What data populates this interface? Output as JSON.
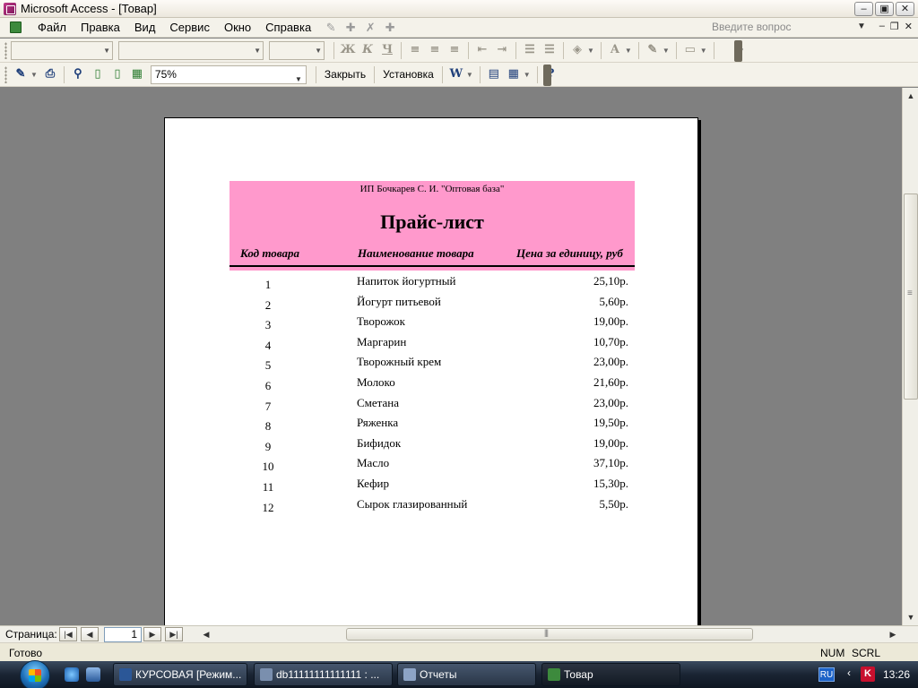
{
  "window": {
    "title": "Microsoft Access - [Товар]"
  },
  "menu": {
    "items": [
      {
        "label": "Файл"
      },
      {
        "label": "Правка"
      },
      {
        "label": "Вид"
      },
      {
        "label": "Сервис"
      },
      {
        "label": "Окно"
      },
      {
        "label": "Справка"
      }
    ],
    "ask_placeholder": "Введите вопрос"
  },
  "format_toolbar": {
    "bold_icon": "Ж",
    "italic_icon": "К",
    "underline_icon": "Ч",
    "font_color_icon": "A"
  },
  "preview_toolbar": {
    "zoom": "75%",
    "close_label": "Закрыть",
    "setup_label": "Установка"
  },
  "report": {
    "company": "ИП Бочкарев С. И. \"Оптовая база\"",
    "title": "Прайс-лист",
    "columns": [
      "Код товара",
      "Наименование товара",
      "Цена за единицу, руб"
    ],
    "header_bg": "#ff99cc",
    "rows": [
      {
        "code": "1",
        "name": "Напиток йогуртный",
        "price": "25,10р."
      },
      {
        "code": "2",
        "name": "Йогурт питьевой",
        "price": "5,60р."
      },
      {
        "code": "3",
        "name": "Творожок",
        "price": "19,00р."
      },
      {
        "code": "4",
        "name": "Маргарин",
        "price": "10,70р."
      },
      {
        "code": "5",
        "name": "Творожный крем",
        "price": "23,00р."
      },
      {
        "code": "6",
        "name": "Молоко",
        "price": "21,60р."
      },
      {
        "code": "7",
        "name": "Сметана",
        "price": "23,00р."
      },
      {
        "code": "8",
        "name": "Ряженка",
        "price": "19,50р."
      },
      {
        "code": "9",
        "name": "Бифидок",
        "price": "19,00р."
      },
      {
        "code": "10",
        "name": "Масло",
        "price": "37,10р."
      },
      {
        "code": "11",
        "name": "Кефир",
        "price": "15,30р."
      },
      {
        "code": "12",
        "name": "Сырок глазированный",
        "price": "5,50р."
      }
    ]
  },
  "navigation": {
    "label": "Страница:",
    "page": "1"
  },
  "status": {
    "text": "Готово",
    "num": "NUM",
    "scrl": "SCRL"
  },
  "taskbar": {
    "items": [
      {
        "label": "КУРСОВАЯ [Режим..."
      },
      {
        "label": "db11111111111111 : ..."
      },
      {
        "label": "Отчеты"
      },
      {
        "label": "Товар"
      }
    ],
    "lang": "RU",
    "clock": "13:26"
  }
}
